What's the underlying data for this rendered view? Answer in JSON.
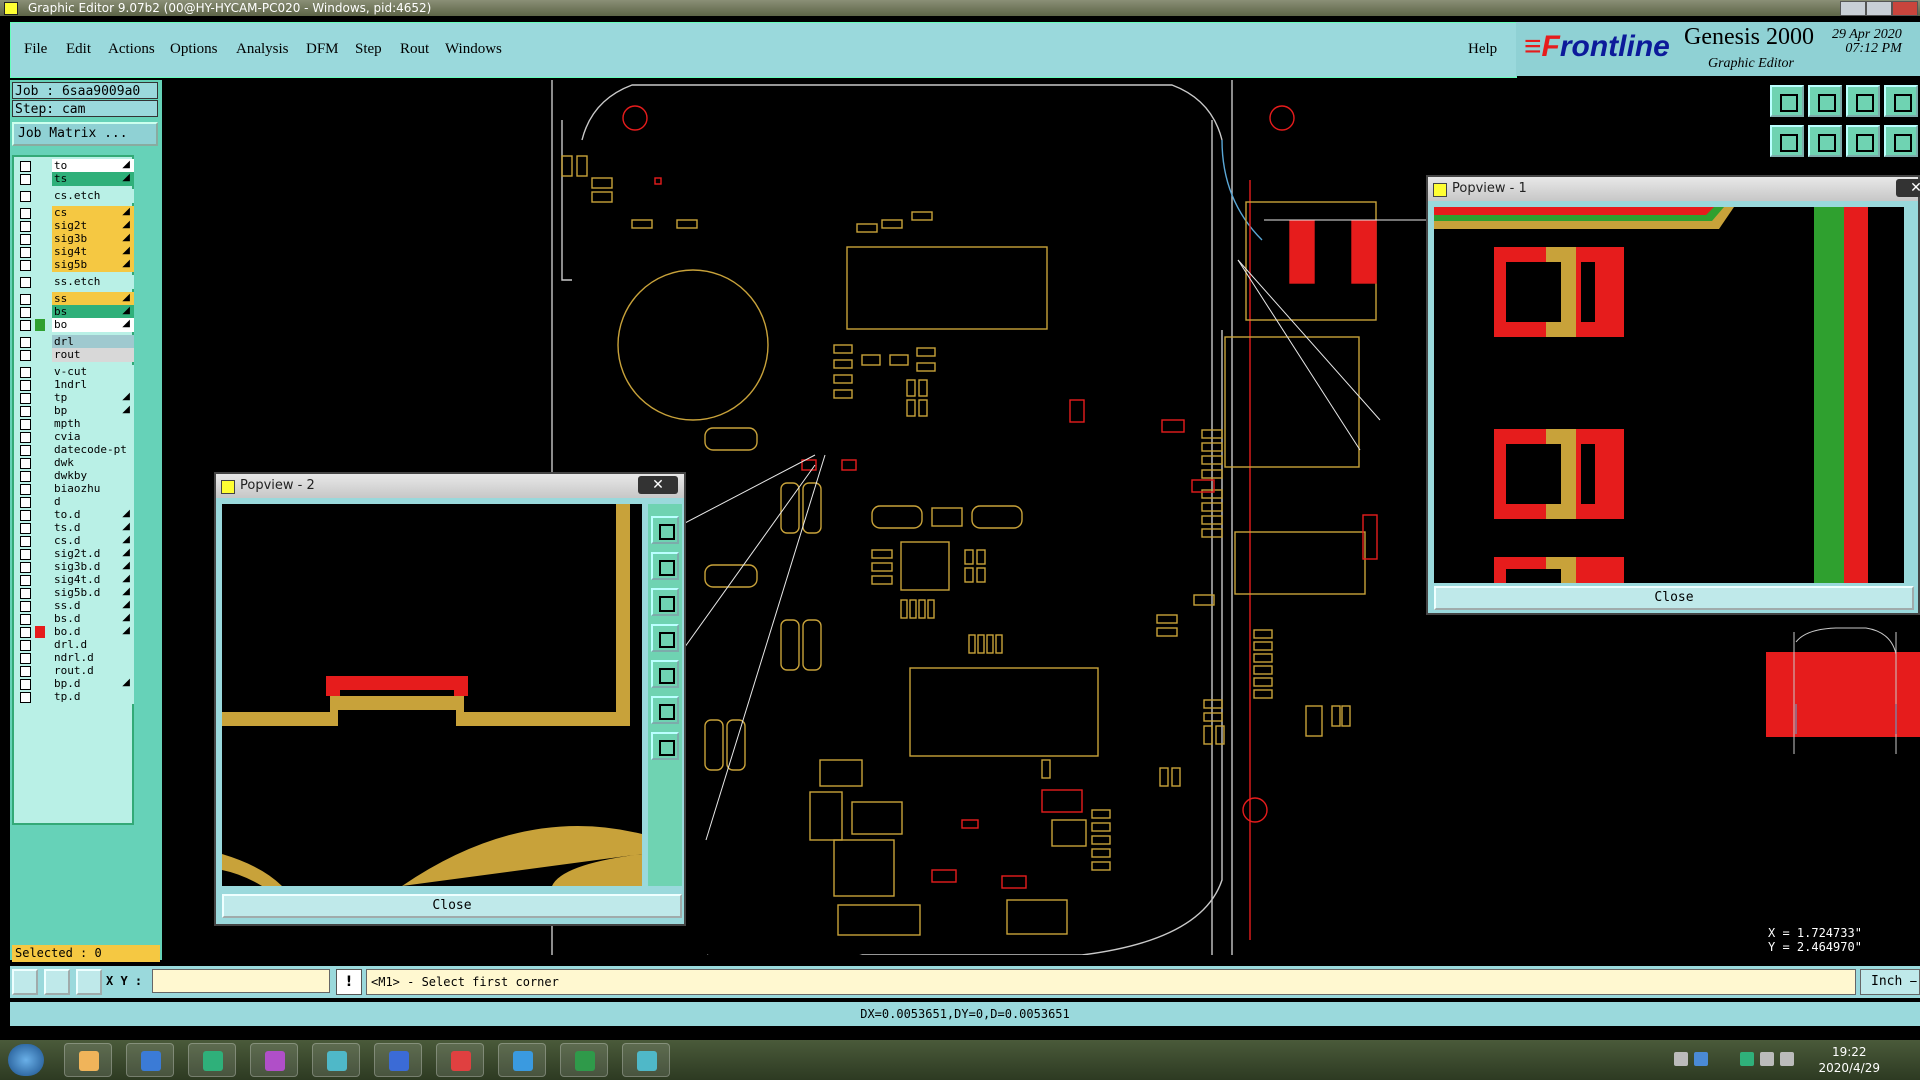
{
  "window": {
    "title": "Graphic Editor 9.07b2 (00@HY-HYCAM-PC020 - Windows, pid:4652)"
  },
  "menu": [
    "File",
    "Edit",
    "Actions",
    "Options",
    "Analysis",
    "DFM",
    "Step",
    "Rout",
    "Windows"
  ],
  "help": "Help",
  "brand": {
    "logo_accent": "≡F",
    "logo_rest": "rontline",
    "product": "Genesis 2000",
    "subtitle": "Graphic Editor",
    "date": "29 Apr 2020",
    "time": "07:12 PM"
  },
  "job": {
    "job_label": "Job : 6saa9009a0",
    "step_label": "Step: cam",
    "matrix_button": "Job Matrix ..."
  },
  "layers": [
    {
      "name": "to",
      "color": "#ffffff",
      "swatch": "",
      "mark": "◢"
    },
    {
      "name": "ts",
      "color": "#2fb07a",
      "swatch": "",
      "mark": "◢"
    },
    {
      "name": "cs.etch",
      "color": "#b9f0e6",
      "swatch": "",
      "mark": ""
    },
    {
      "name": "cs",
      "color": "#f5c842",
      "swatch": "",
      "mark": "◢"
    },
    {
      "name": "sig2t",
      "color": "#f5c842",
      "swatch": "",
      "mark": "◢"
    },
    {
      "name": "sig3b",
      "color": "#f5c842",
      "swatch": "",
      "mark": "◢"
    },
    {
      "name": "sig4t",
      "color": "#f5c842",
      "swatch": "",
      "mark": "◢"
    },
    {
      "name": "sig5b",
      "color": "#f5c842",
      "swatch": "",
      "mark": "◢"
    },
    {
      "name": "ss.etch",
      "color": "#b9f0e6",
      "swatch": "",
      "mark": ""
    },
    {
      "name": "ss",
      "color": "#f5c842",
      "swatch": "",
      "mark": "◢"
    },
    {
      "name": "bs",
      "color": "#2fb07a",
      "swatch": "",
      "mark": "◢"
    },
    {
      "name": "bo",
      "color": "#ffffff",
      "swatch": "#2fa02f",
      "mark": "◢"
    },
    {
      "name": "drl",
      "color": "#9fc9cf",
      "swatch": "",
      "mark": ""
    },
    {
      "name": "rout",
      "color": "#d8d8d8",
      "swatch": "",
      "mark": ""
    },
    {
      "name": "v-cut",
      "color": "#b9f0e6",
      "swatch": "",
      "mark": ""
    },
    {
      "name": "1ndrl",
      "color": "#b9f0e6",
      "swatch": "",
      "mark": ""
    },
    {
      "name": "tp",
      "color": "#b9f0e6",
      "swatch": "",
      "mark": "◢"
    },
    {
      "name": "bp",
      "color": "#b9f0e6",
      "swatch": "",
      "mark": "◢"
    },
    {
      "name": "mpth",
      "color": "#b9f0e6",
      "swatch": "",
      "mark": ""
    },
    {
      "name": "cvia",
      "color": "#b9f0e6",
      "swatch": "",
      "mark": ""
    },
    {
      "name": "datecode-pt",
      "color": "#b9f0e6",
      "swatch": "",
      "mark": ""
    },
    {
      "name": "dwk",
      "color": "#b9f0e6",
      "swatch": "",
      "mark": ""
    },
    {
      "name": "dwkby",
      "color": "#b9f0e6",
      "swatch": "",
      "mark": ""
    },
    {
      "name": "biaozhu",
      "color": "#b9f0e6",
      "swatch": "",
      "mark": ""
    },
    {
      "name": "d",
      "color": "#b9f0e6",
      "swatch": "",
      "mark": ""
    },
    {
      "name": "to.d",
      "color": "#b9f0e6",
      "swatch": "",
      "mark": "◢"
    },
    {
      "name": "ts.d",
      "color": "#b9f0e6",
      "swatch": "",
      "mark": "◢"
    },
    {
      "name": "cs.d",
      "color": "#b9f0e6",
      "swatch": "",
      "mark": "◢"
    },
    {
      "name": "sig2t.d",
      "color": "#b9f0e6",
      "swatch": "",
      "mark": "◢"
    },
    {
      "name": "sig3b.d",
      "color": "#b9f0e6",
      "swatch": "",
      "mark": "◢"
    },
    {
      "name": "sig4t.d",
      "color": "#b9f0e6",
      "swatch": "",
      "mark": "◢"
    },
    {
      "name": "sig5b.d",
      "color": "#b9f0e6",
      "swatch": "",
      "mark": "◢"
    },
    {
      "name": "ss.d",
      "color": "#b9f0e6",
      "swatch": "",
      "mark": "◢"
    },
    {
      "name": "bs.d",
      "color": "#b9f0e6",
      "swatch": "",
      "mark": "◢"
    },
    {
      "name": "bo.d",
      "color": "#b9f0e6",
      "swatch": "#e61c1c",
      "mark": "◢"
    },
    {
      "name": "drl.d",
      "color": "#b9f0e6",
      "swatch": "",
      "mark": ""
    },
    {
      "name": "ndrl.d",
      "color": "#b9f0e6",
      "swatch": "",
      "mark": ""
    },
    {
      "name": "rout.d",
      "color": "#b9f0e6",
      "swatch": "",
      "mark": ""
    },
    {
      "name": "bp.d",
      "color": "#b9f0e6",
      "swatch": "",
      "mark": "◢"
    },
    {
      "name": "tp.d",
      "color": "#b9f0e6",
      "swatch": "",
      "mark": ""
    }
  ],
  "selected": "Selected : 0",
  "popview1": {
    "title": "Popview - 1",
    "close": "Close",
    "close_x": "✕"
  },
  "popview2": {
    "title": "Popview - 2",
    "close": "Close",
    "close_x": "✕"
  },
  "coords": {
    "x": "X = 1.724733\"",
    "y": "Y = 2.464970\""
  },
  "cmd": {
    "xy_label": "X Y :",
    "warn": "!",
    "prompt": "<M1> - Select first corner",
    "unit": "Inch ⎯"
  },
  "status": "DX=0.0053651,DY=0,D=0.0053651",
  "taskbar": {
    "time": "19:22",
    "date": "2020/4/29"
  }
}
